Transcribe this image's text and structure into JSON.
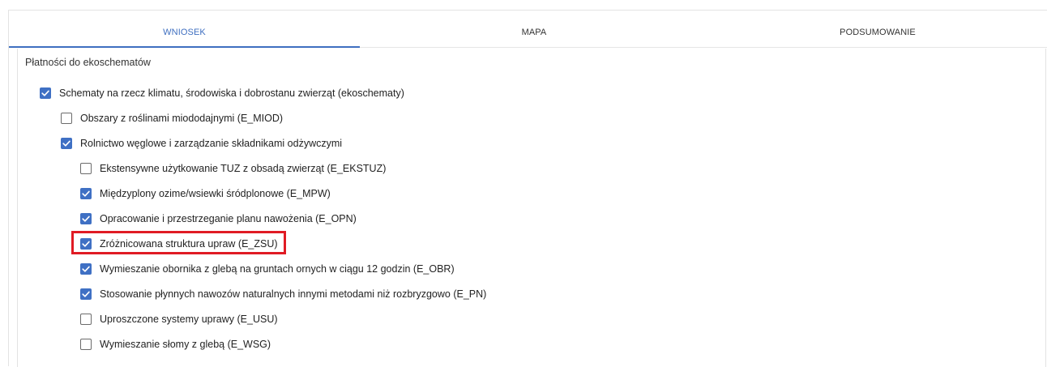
{
  "tabs": [
    {
      "label": "WNIOSEK",
      "active": true
    },
    {
      "label": "MAPA",
      "active": false
    },
    {
      "label": "PODSUMOWANIE",
      "active": false
    }
  ],
  "section_title": "Płatności do ekoschematów",
  "items": [
    {
      "label": "Schematy na rzecz klimatu, środowiska i dobrostanu zwierząt (ekoschematy)",
      "checked": true,
      "level": 0
    },
    {
      "label": "Obszary z roślinami miododajnymi (E_MIOD)",
      "checked": false,
      "level": 1
    },
    {
      "label": "Rolnictwo węglowe i zarządzanie składnikami odżywczymi",
      "checked": true,
      "level": 1
    },
    {
      "label": "Ekstensywne użytkowanie TUZ z obsadą zwierząt (E_EKSTUZ)",
      "checked": false,
      "level": 2
    },
    {
      "label": "Międzyplony ozime/wsiewki śródplonowe (E_MPW)",
      "checked": true,
      "level": 2
    },
    {
      "label": "Opracowanie i przestrzeganie planu nawożenia (E_OPN)",
      "checked": true,
      "level": 2
    },
    {
      "label": "Zróżnicowana struktura upraw (E_ZSU)",
      "checked": true,
      "level": 2,
      "highlighted": true
    },
    {
      "label": "Wymieszanie obornika z glebą na gruntach ornych w ciągu 12 godzin (E_OBR)",
      "checked": true,
      "level": 2
    },
    {
      "label": "Stosowanie płynnych nawozów naturalnych innymi metodami niż rozbryzgowo (E_PN)",
      "checked": true,
      "level": 2
    },
    {
      "label": "Uproszczone systemy uprawy (E_USU)",
      "checked": false,
      "level": 2
    },
    {
      "label": "Wymieszanie słomy z glebą (E_WSG)",
      "checked": false,
      "level": 2
    }
  ],
  "colors": {
    "accent": "#3f70c4",
    "highlight": "#e01b24",
    "checkbox_border": "#6b6b6b"
  },
  "icons": {
    "checked": "check-icon"
  }
}
